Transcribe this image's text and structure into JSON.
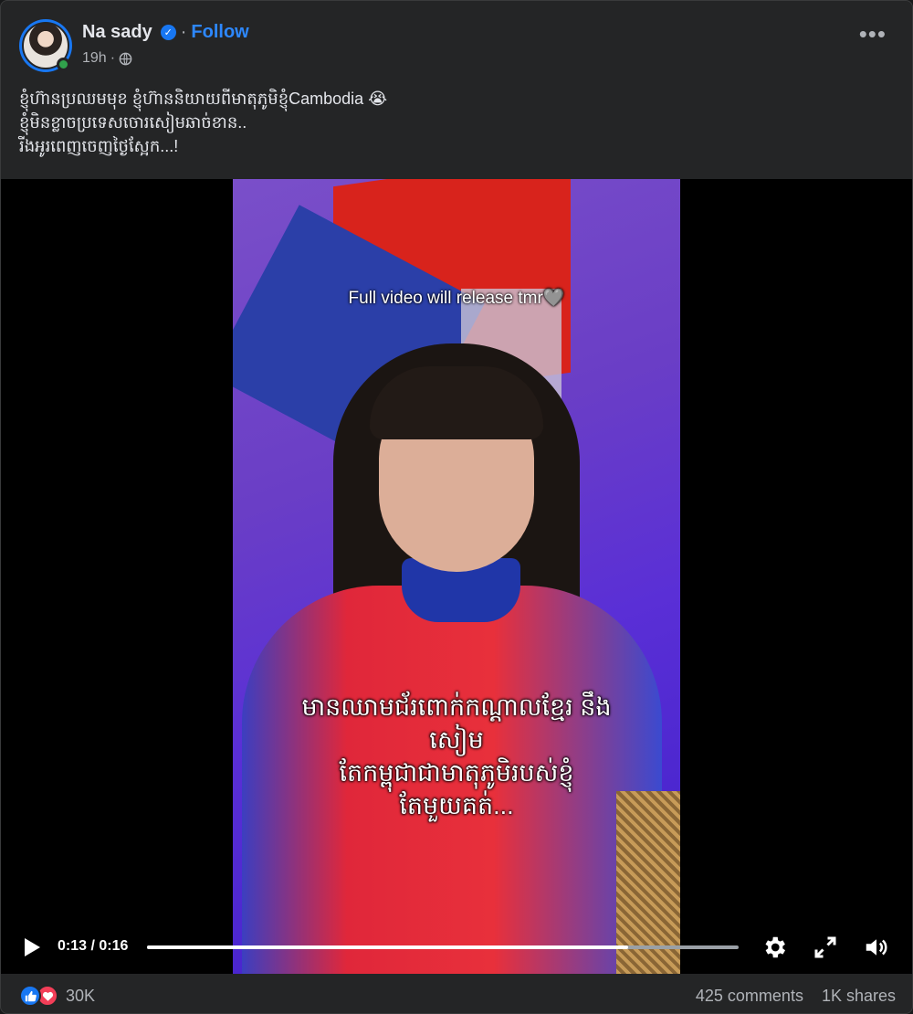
{
  "header": {
    "name": "Na sady",
    "follow_label": "Follow",
    "separator": "·",
    "timestamp": "19h",
    "time_separator": "·"
  },
  "caption": {
    "lines": [
      "ខ្ញុំហ៊ានប្រឈមមុខ ខ្ញុំហ៊ាននិយាយពីមាតុភូមិខ្ញុំCambodia 😭",
      "ខ្ញុំមិនខ្លាចប្រទេសចោរសៀមឆាច់ខាន..",
      "រីងអូរពេញចេញថ្ងៃស្អែក...!"
    ]
  },
  "video": {
    "overlay_top": "Full video will release tmr🩶",
    "subtitle_lines": [
      "មានឈាមជ័រពោក់កណ្តាលខ្មែរ នឹង",
      "សៀម",
      "តែកម្ពុជាជាមាតុភូមិរបស់ខ្ញុំ",
      "តែមួយគត់..."
    ],
    "time": "0:13 / 0:16",
    "progress": 0.8125
  },
  "footer": {
    "reaction_count": "30K",
    "comments": "425 comments",
    "shares": "1K shares"
  },
  "icons": {
    "more": "more-options-icon",
    "globe": "globe-icon",
    "verified": "verified-badge-icon",
    "play": "play-icon",
    "settings": "gear-icon",
    "fullscreen": "fullscreen-icon",
    "volume": "volume-icon",
    "like": "like-reaction-icon",
    "love": "love-reaction-icon"
  },
  "colors": {
    "accent": "#2d88ff",
    "card": "#242526",
    "like": "#1877f2",
    "love": "#f33e58",
    "online": "#31a24c"
  }
}
